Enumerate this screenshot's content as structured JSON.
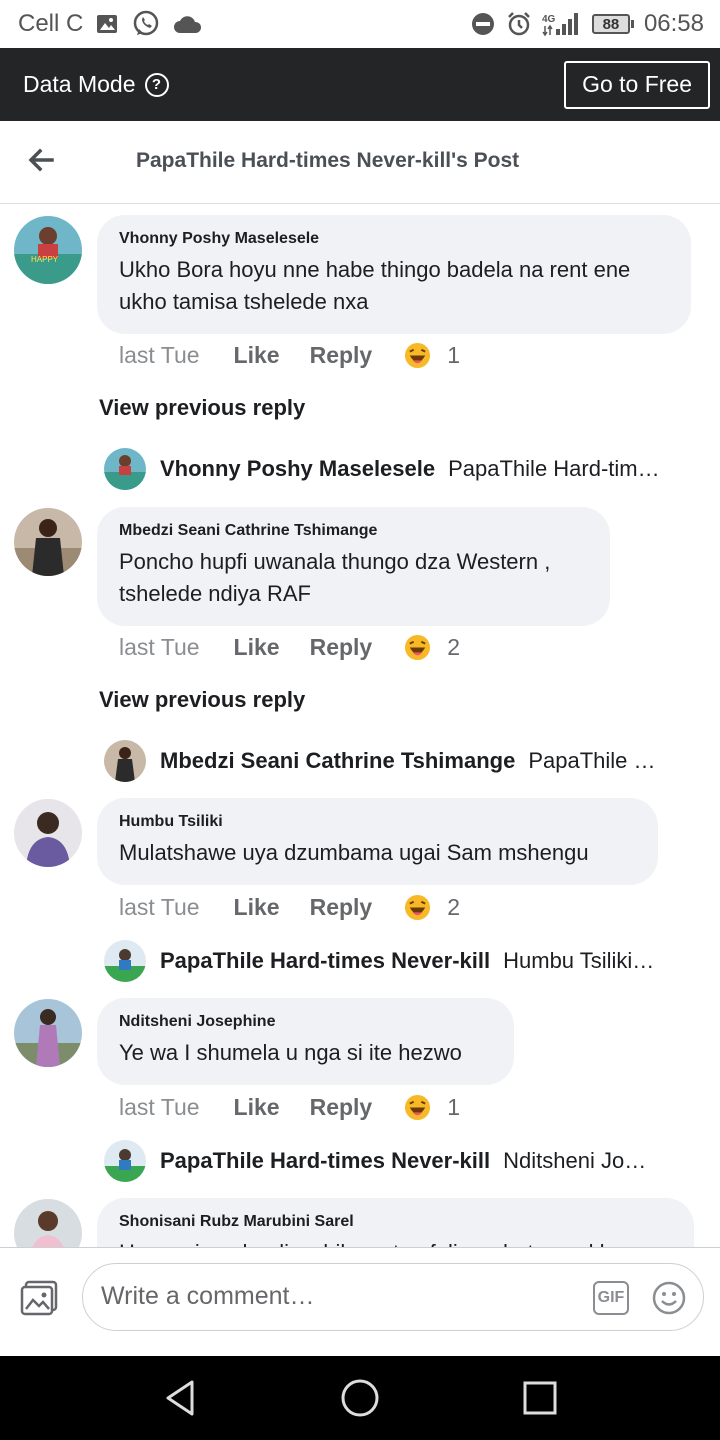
{
  "status_bar": {
    "carrier": "Cell C",
    "network": "4G",
    "battery": "88",
    "time": "06:58",
    "icons": [
      "gallery-icon",
      "whatsapp-icon",
      "cloud-icon",
      "do-not-disturb-icon",
      "alarm-icon",
      "signal-icon",
      "battery-icon"
    ]
  },
  "data_bar": {
    "label": "Data Mode",
    "help_symbol": "?",
    "button": "Go to Free"
  },
  "header": {
    "title": "PapaThile Hard-times Never-kill's Post"
  },
  "comments": [
    {
      "author": "Vhonny Poshy Maselesele",
      "text": "Ukho Bora hoyu nne habe thingo badela na rent ene ukho tamisa tshelede nxa",
      "time": "last Tue",
      "like": "Like",
      "reply": "Reply",
      "reaction_count": "1",
      "view_previous": "View previous reply",
      "reply_preview": {
        "name": "Vhonny Poshy Maselesele",
        "text": "PapaThile Hard-tim…"
      }
    },
    {
      "author": "Mbedzi Seani Cathrine Tshimange",
      "text": "Poncho hupfi uwanala thungo dza Western , tshelede ndiya RAF",
      "time": "last Tue",
      "like": "Like",
      "reply": "Reply",
      "reaction_count": "2",
      "view_previous": "View previous reply",
      "reply_preview": {
        "name": "Mbedzi Seani Cathrine Tshimange",
        "text": "PapaThile …"
      }
    },
    {
      "author": "Humbu Tsiliki",
      "text": "Mulatshawe uya dzumbama ugai Sam mshengu",
      "time": "last Tue",
      "like": "Like",
      "reply": "Reply",
      "reaction_count": "2",
      "reply_preview": {
        "name": "PapaThile Hard-times Never-kill",
        "text": "Humbu Tsiliki…"
      }
    },
    {
      "author": "Nditsheni Josephine",
      "text": "Ye wa I shumela u nga si ite hezwo",
      "time": "last Tue",
      "like": "Like",
      "reply": "Reply",
      "reaction_count": "1",
      "reply_preview": {
        "name": "PapaThile Hard-times Never-kill",
        "text": "Nditsheni Jo…"
      }
    },
    {
      "author": "Shonisani Rubz Marubini Sarel",
      "text": "Haya a inga hualiwa hiko vata nfaliwa vhutungu kha"
    }
  ],
  "composer": {
    "placeholder": "Write a comment…",
    "gif_label": "GIF"
  },
  "colors": {
    "data_bar_bg": "#242526",
    "bubble_bg": "#f0f2f5",
    "muted_text": "#65676b"
  }
}
